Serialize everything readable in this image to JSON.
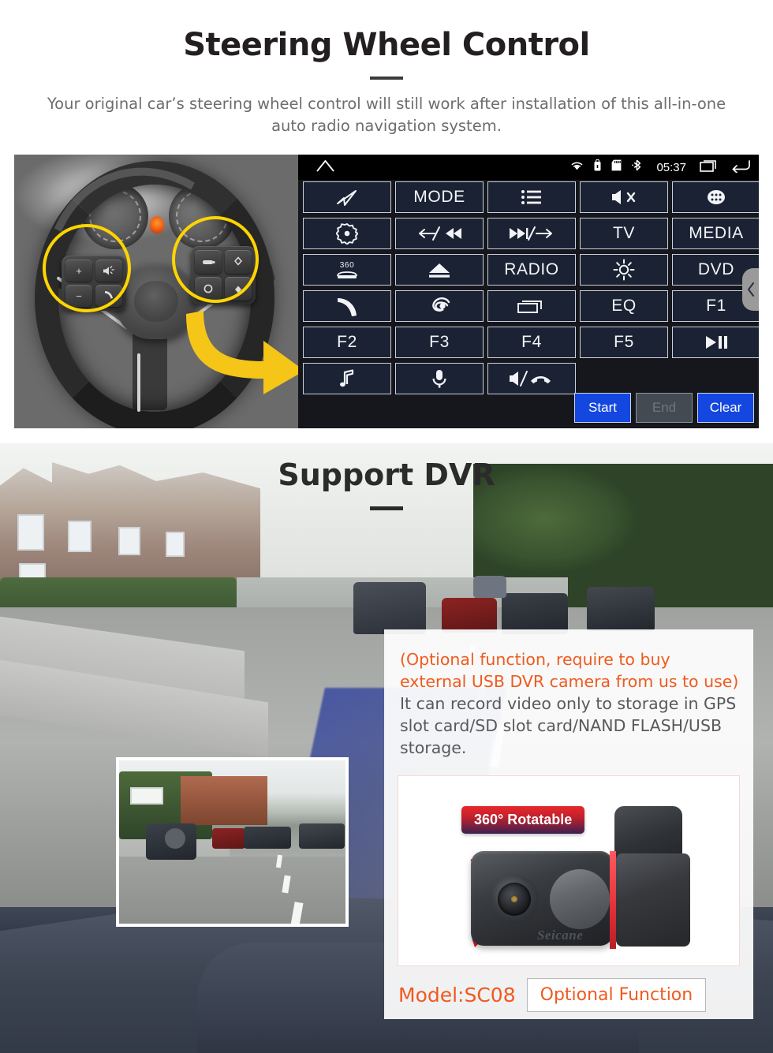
{
  "section1": {
    "title": "Steering Wheel Control",
    "subtitle": "Your original car’s steering wheel control will still work after installation of this all-in-one auto radio navigation system.",
    "photo_alt": "car-steering-wheel-with-highlighted-control-pods",
    "head_unit": {
      "statusbar": {
        "home_icon": "home-icon",
        "wifi_icon": "wifi-icon",
        "usb_icon": "usb-icon",
        "sdcard_icon": "sd-card-icon",
        "bluetooth_icon": "bluetooth-icon",
        "clock": "05:37",
        "recents_icon": "recent-apps-icon",
        "back_icon": "back-arrow-icon"
      },
      "buttons": [
        {
          "label": "",
          "icon": "navigation-arrow-icon"
        },
        {
          "label": "MODE",
          "icon": ""
        },
        {
          "label": "",
          "icon": "list-menu-icon"
        },
        {
          "label": "",
          "icon": "mute-speaker-icon"
        },
        {
          "label": "",
          "icon": "app-drawer-icon"
        },
        {
          "label": "",
          "icon": "power-eye-icon"
        },
        {
          "label": "",
          "icon": "previous-track-icon"
        },
        {
          "label": "",
          "icon": "next-track-icon"
        },
        {
          "label": "TV",
          "icon": ""
        },
        {
          "label": "MEDIA",
          "icon": ""
        },
        {
          "label": "",
          "icon": "360-car-view-icon"
        },
        {
          "label": "",
          "icon": "eject-icon"
        },
        {
          "label": "RADIO",
          "icon": ""
        },
        {
          "label": "",
          "icon": "brightness-icon"
        },
        {
          "label": "DVD",
          "icon": ""
        },
        {
          "label": "",
          "icon": "phone-call-icon"
        },
        {
          "label": "",
          "icon": "swirl-logo-icon"
        },
        {
          "label": "",
          "icon": "screen-window-icon"
        },
        {
          "label": "EQ",
          "icon": ""
        },
        {
          "label": "F1",
          "icon": ""
        },
        {
          "label": "F2",
          "icon": ""
        },
        {
          "label": "F3",
          "icon": ""
        },
        {
          "label": "F4",
          "icon": ""
        },
        {
          "label": "F5",
          "icon": ""
        },
        {
          "label": "",
          "icon": "play-pause-icon"
        },
        {
          "label": "",
          "icon": "music-note-icon"
        },
        {
          "label": "",
          "icon": "microphone-icon"
        },
        {
          "label": "",
          "icon": "volume-hangup-icon"
        }
      ],
      "actions": {
        "start": "Start",
        "end": "End",
        "clear": "Clear"
      },
      "scroll_icon": "chevron-left-icon"
    }
  },
  "section2": {
    "title": "Support DVR",
    "info_orange": "(Optional function, require to buy external USB DVR camera from us to use)",
    "info_gray": "It can record video only to storage in GPS slot card/SD slot card/NAND FLASH/USB storage.",
    "product": {
      "badge": "360° Rotatable",
      "watermark": "Seicane",
      "rotation_icon": "rotation-arrows-icon"
    },
    "model_label": "Model:SC08",
    "optional_label": "Optional Function",
    "inset_alt": "dvr-recorded-road-video-thumbnail"
  },
  "colors": {
    "accent_orange": "#ef5a1f",
    "highlight_yellow": "#ffd400",
    "button_blue": "#1447e0",
    "unit_bg": "#15171c",
    "button_face": "#1b2233"
  }
}
